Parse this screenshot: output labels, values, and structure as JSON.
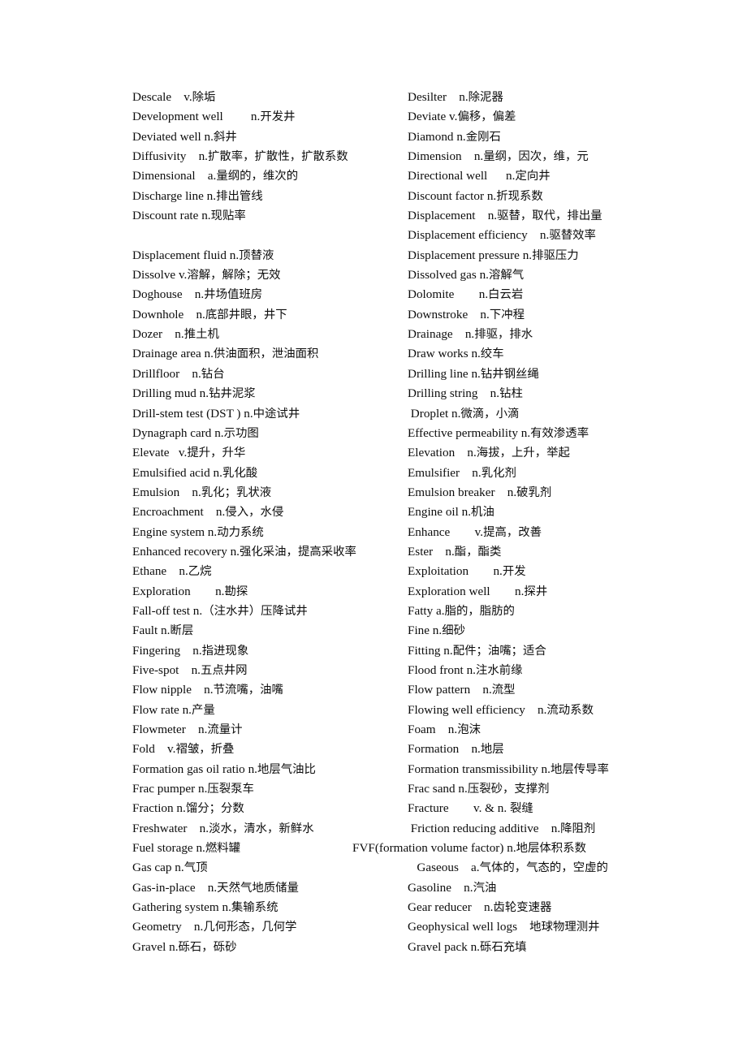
{
  "document": {
    "kind": "bilingual-glossary",
    "language_pair": "English-Chinese",
    "subject": "petroleum engineering",
    "background_color": "#ffffff",
    "text_color": "#0d0d0d",
    "columns": 2
  },
  "entries": [
    {
      "line": 1,
      "left": "Descale    v.除垢",
      "right": "Desilter    n.除泥器"
    },
    {
      "line": 2,
      "left": "Development well         n.开发井",
      "right": "Deviate v.偏移，偏差"
    },
    {
      "line": 3,
      "left": "Deviated well n.斜井",
      "right": "Diamond n.金刚石"
    },
    {
      "line": 4,
      "left": "Diffusivity    n.扩散率，扩散性，扩散系数",
      "right": "Dimension    n.量纲，因次，维，元"
    },
    {
      "line": 5,
      "left": "Dimensional    a.量纲的，维次的",
      "right": "Directional well      n.定向井"
    },
    {
      "line": 6,
      "left": "Discharge line n.排出管线",
      "right": "Discount factor n.折现系数"
    },
    {
      "line": 7,
      "left": "Discount rate n.现贴率",
      "right": "Displacement    n.驱替，取代，排出量"
    },
    {
      "line": 8,
      "left": "",
      "right": "Displacement efficiency    n.驱替效率"
    },
    {
      "line": 9,
      "left": "Displacement fluid n.顶替液",
      "right": "Displacement pressure n.排驱压力"
    },
    {
      "line": 10,
      "left": "Dissolve v.溶解，解除；无效",
      "right": "Dissolved gas n.溶解气"
    },
    {
      "line": 11,
      "left": "Doghouse    n.井场值班房",
      "right": "Dolomite        n.白云岩"
    },
    {
      "line": 12,
      "left": "Downhole    n.底部井眼，井下",
      "right": "Downstroke    n.下冲程"
    },
    {
      "line": 13,
      "left": "Dozer    n.推土机",
      "right": "Drainage    n.排驱，排水"
    },
    {
      "line": 14,
      "left": "Drainage area n.供油面积，泄油面积",
      "right": "Draw works n.绞车"
    },
    {
      "line": 15,
      "left": "Drillfloor    n.钻台",
      "right": "Drilling line n.钻井钢丝绳"
    },
    {
      "line": 16,
      "left": "Drilling mud n.钻井泥浆",
      "right": "Drilling string    n.钻柱"
    },
    {
      "line": 17,
      "left": "Drill-stem test (DST ) n.中途试井",
      "right": " Droplet n.微滴，小滴"
    },
    {
      "line": 18,
      "left": "Dynagraph card n.示功图",
      "right": "Effective permeability n.有效渗透率"
    },
    {
      "line": 19,
      "left": "Elevate   v.提升，升华",
      "right": "Elevation    n.海拔，上升，举起"
    },
    {
      "line": 20,
      "left": "Emulsified acid n.乳化酸",
      "right": "Emulsifier    n.乳化剂"
    },
    {
      "line": 21,
      "left": "Emulsion    n.乳化；乳状液",
      "right": "Emulsion breaker    n.破乳剂"
    },
    {
      "line": 22,
      "left": "Encroachment    n.侵入，水侵",
      "right": "Engine oil n.机油"
    },
    {
      "line": 23,
      "left": "Engine system n.动力系统",
      "right": "Enhance        v.提高，改善"
    },
    {
      "line": 24,
      "left": "Enhanced recovery n.强化采油，提高采收率",
      "right": "Ester    n.酯，酯类"
    },
    {
      "line": 25,
      "left": "Ethane    n.乙烷",
      "right": "Exploitation        n.开发"
    },
    {
      "line": 26,
      "left": "Exploration        n.勘探",
      "right": "Exploration well        n.探井"
    },
    {
      "line": 27,
      "left": "Fall-off test n.（注水井）压降试井",
      "right": "Fatty a.脂的，脂肪的"
    },
    {
      "line": 28,
      "left": "Fault n.断层",
      "right": "Fine n.细砂"
    },
    {
      "line": 29,
      "left": "Fingering    n.指进现象",
      "right": "Fitting n.配件；油嘴；适合"
    },
    {
      "line": 30,
      "left": "Five-spot    n.五点井网",
      "right": "Flood front n.注水前缘"
    },
    {
      "line": 31,
      "left": "Flow nipple    n.节流嘴，油嘴",
      "right": "Flow pattern    n.流型"
    },
    {
      "line": 32,
      "left": "Flow rate n.产量",
      "right": "Flowing well efficiency    n.流动系数"
    },
    {
      "line": 33,
      "left": "Flowmeter    n.流量计",
      "right": "Foam    n.泡沫"
    },
    {
      "line": 34,
      "left": "Fold    v.褶皱，折叠",
      "right": "Formation    n.地层"
    },
    {
      "line": 35,
      "left": "Formation gas oil ratio n.地层气油比",
      "right": "Formation transmissibility n.地层传导率"
    },
    {
      "line": 36,
      "left": "Frac pumper n.压裂泵车",
      "right": "Frac sand n.压裂砂，支撑剂"
    },
    {
      "line": 37,
      "left": "Fraction n.馏分；分数",
      "right": "Fracture        v. & n. 裂缝"
    },
    {
      "line": 38,
      "left": "Freshwater    n.淡水，清水，新鲜水",
      "right": " Friction reducing additive    n.降阻剂"
    },
    {
      "line": 39,
      "left": "Fuel storage n.燃料罐",
      "right": "FVF(formation volume factor) n.地层体积系数",
      "right_shifted": true
    },
    {
      "line": 40,
      "left": "Gas cap n.气顶",
      "right": "   Gaseous    a.气体的，气态的，空虚的"
    },
    {
      "line": 41,
      "left": "Gas-in-place    n.天然气地质储量",
      "right": "Gasoline    n.汽油"
    },
    {
      "line": 42,
      "left": "Gathering system n.集输系统",
      "right": "Gear reducer    n.齿轮变速器"
    },
    {
      "line": 43,
      "left": "Geometry    n.几何形态，几何学",
      "right": "Geophysical well logs    地球物理测井"
    },
    {
      "line": 44,
      "left": "Gravel n.砾石，砾砂",
      "right": "Gravel pack n.砾石充填"
    }
  ]
}
